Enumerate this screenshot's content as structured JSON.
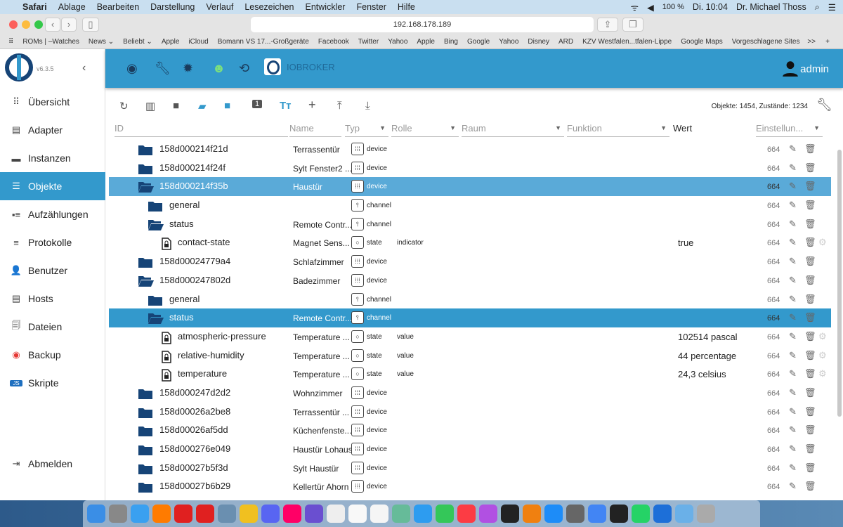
{
  "menubar": {
    "apple": "",
    "app": "Safari",
    "items": [
      "Ablage",
      "Bearbeiten",
      "Darstellung",
      "Verlauf",
      "Lesezeichen",
      "Entwickler",
      "Fenster",
      "Hilfe"
    ],
    "battery": "100 %",
    "clock": "Di. 10:04",
    "user": "Dr. Michael Thoss"
  },
  "browser": {
    "url": "192.168.178.189",
    "bookmarks": [
      "ROMs | –Watches",
      "News ⌄",
      "Beliebt ⌄",
      "Apple",
      "iCloud",
      "Bomann VS 17...-Großgeräte",
      "Facebook",
      "Twitter",
      "Yahoo",
      "Apple",
      "Bing",
      "Google",
      "Yahoo",
      "Disney",
      "ARD",
      "KZV Westfalen...tfalen-Lippe",
      "Google Maps",
      "Vorgeschlagene Sites"
    ],
    "more": ">>",
    "add": "+"
  },
  "app": {
    "version": "v6.3.5",
    "title": "IOBROKER",
    "user": "admin",
    "header_icons": [
      "eye-icon",
      "wrench-icon",
      "brightness-icon",
      "expert-mode-icon",
      "sync-disabled-icon"
    ]
  },
  "sidebar": {
    "items": [
      {
        "label": "Übersicht",
        "icon": "apps-icon",
        "glyph": "⠿"
      },
      {
        "label": "Adapter",
        "icon": "store-icon",
        "glyph": "▤"
      },
      {
        "label": "Instanzen",
        "icon": "instances-icon",
        "glyph": "▬"
      },
      {
        "label": "Objekte",
        "icon": "list-icon",
        "glyph": "☰",
        "active": true
      },
      {
        "label": "Aufzählungen",
        "icon": "enums-icon",
        "glyph": "▪≡"
      },
      {
        "label": "Protokolle",
        "icon": "log-icon",
        "glyph": "≡"
      },
      {
        "label": "Benutzer",
        "icon": "user-icon",
        "glyph": "👤"
      },
      {
        "label": "Hosts",
        "icon": "hosts-icon",
        "glyph": "▤"
      },
      {
        "label": "Dateien",
        "icon": "files-icon",
        "glyph": "🗐"
      },
      {
        "label": "Backup",
        "icon": "backup-icon",
        "glyph": "◉"
      },
      {
        "label": "Skripte",
        "icon": "javascript-icon",
        "glyph": "JS"
      }
    ],
    "logout": "Abmelden"
  },
  "objects": {
    "counts": "Objekte: 1454, Zustände: 1234",
    "columns": {
      "id": "ID",
      "name": "Name",
      "type": "Typ",
      "role": "Rolle",
      "room": "Raum",
      "function": "Funktion",
      "value": "Wert",
      "settings": "Einstellun..."
    },
    "rows": [
      {
        "id": "158d000214f21d",
        "name": "Terrassentür",
        "type": "device",
        "level": 1,
        "icon": "folder-closed"
      },
      {
        "id": "158d000214f24f",
        "name": "Sylt Fenster2 ...",
        "type": "device",
        "level": 1,
        "icon": "folder-closed"
      },
      {
        "id": "158d000214f35b",
        "name": "Haustür",
        "type": "device",
        "level": 1,
        "icon": "folder-open",
        "selected": "light"
      },
      {
        "id": "general",
        "name": "",
        "type": "channel",
        "level": 2,
        "icon": "folder-closed"
      },
      {
        "id": "status",
        "name": "Remote Contr...",
        "type": "channel",
        "level": 2,
        "icon": "folder-open"
      },
      {
        "id": "contact-state",
        "name": "Magnet Sens...",
        "type": "state",
        "role": "indicator",
        "value": "true",
        "level": 3,
        "icon": "file-lock"
      },
      {
        "id": "158d00024779a4",
        "name": "Schlafzimmer",
        "type": "device",
        "level": 1,
        "icon": "folder-closed"
      },
      {
        "id": "158d000247802d",
        "name": "Badezimmer",
        "type": "device",
        "level": 1,
        "icon": "folder-open"
      },
      {
        "id": "general",
        "name": "",
        "type": "channel",
        "level": 2,
        "icon": "folder-closed"
      },
      {
        "id": "status",
        "name": "Remote Contr...",
        "type": "channel",
        "level": 2,
        "icon": "folder-open",
        "selected": "dark"
      },
      {
        "id": "atmospheric-pressure",
        "name": "Temperature ...",
        "type": "state",
        "role": "value",
        "value": "102514 pascal",
        "level": 3,
        "icon": "file-lock"
      },
      {
        "id": "relative-humidity",
        "name": "Temperature ...",
        "type": "state",
        "role": "value",
        "value": "44 percentage",
        "level": 3,
        "icon": "file-lock"
      },
      {
        "id": "temperature",
        "name": "Temperature ...",
        "type": "state",
        "role": "value",
        "value": "24,3 celsius",
        "level": 3,
        "icon": "file-lock"
      },
      {
        "id": "158d000247d2d2",
        "name": "Wohnzimmer",
        "type": "device",
        "level": 1,
        "icon": "folder-closed"
      },
      {
        "id": "158d00026a2be8",
        "name": "Terrassentür ...",
        "type": "device",
        "level": 1,
        "icon": "folder-closed"
      },
      {
        "id": "158d00026af5dd",
        "name": "Küchenfenste...",
        "type": "device",
        "level": 1,
        "icon": "folder-closed"
      },
      {
        "id": "158d000276e049",
        "name": "Haustür Lohaus",
        "type": "device",
        "level": 1,
        "icon": "folder-closed"
      },
      {
        "id": "158d00027b5f3d",
        "name": "Sylt Haustür",
        "type": "device",
        "level": 1,
        "icon": "folder-closed"
      },
      {
        "id": "158d00027b6b29",
        "name": "Kellertür Ahorn",
        "type": "device",
        "level": 1,
        "icon": "folder-closed"
      }
    ],
    "acl": "664"
  },
  "dock": {
    "calendar_day": "14",
    "badge": "1"
  }
}
